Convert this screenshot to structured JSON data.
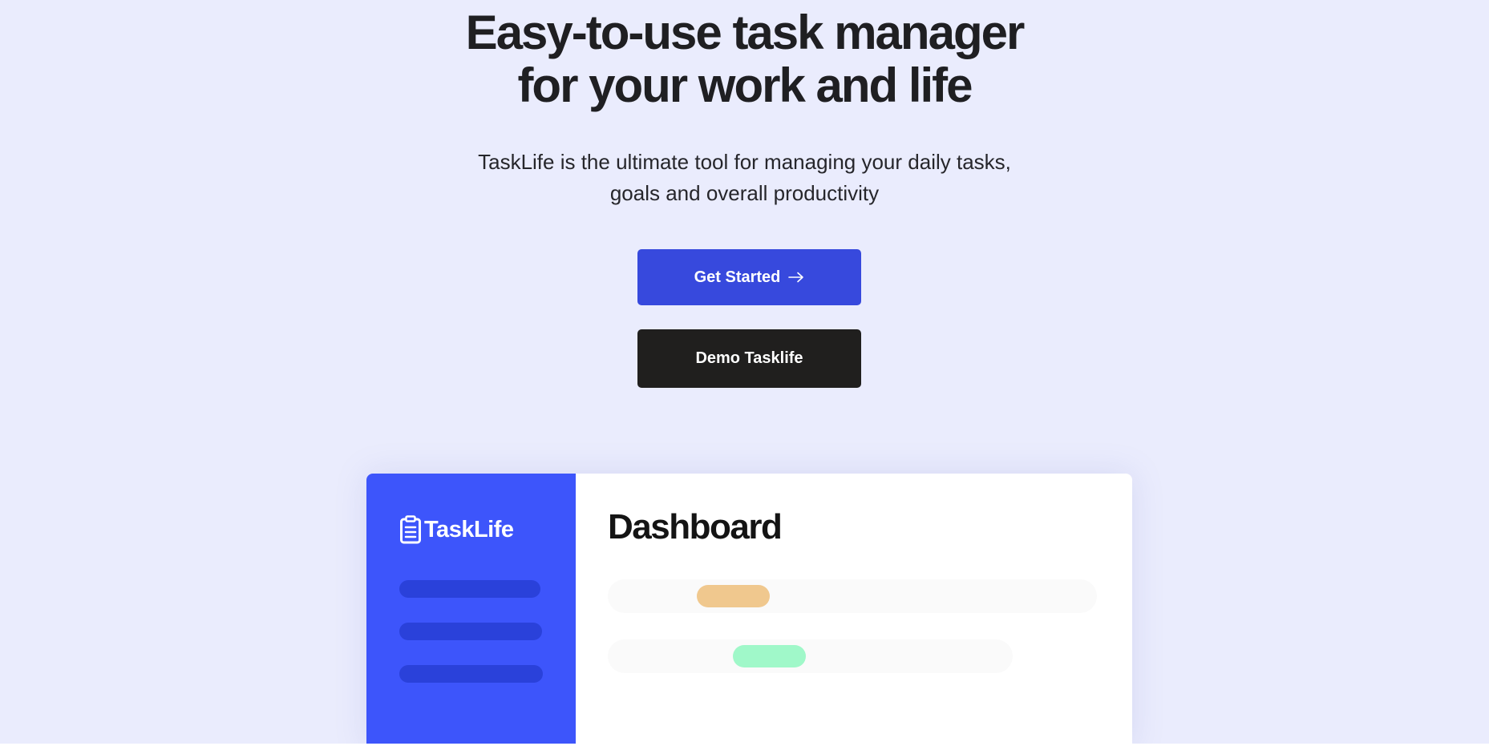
{
  "hero": {
    "headline_line1": "Easy-to-use task manager",
    "headline_line2": "for your work and life",
    "subtitle_line1": "TaskLife is the ultimate tool for managing your daily tasks,",
    "subtitle_line2": "goals and overall productivity",
    "primary_button": "Get Started",
    "secondary_button": "Demo Tasklife"
  },
  "preview": {
    "logo_text": "TaskLife",
    "dashboard_title": "Dashboard"
  },
  "colors": {
    "background": "#eaecfd",
    "primary": "#3749dd",
    "dark": "#201f1e",
    "sidebar": "#3d55fb",
    "pill_orange": "#f0c88e",
    "pill_green": "#a0f8c9"
  },
  "icons": {
    "arrow": "arrow-right-icon",
    "logo": "clipboard-icon"
  }
}
